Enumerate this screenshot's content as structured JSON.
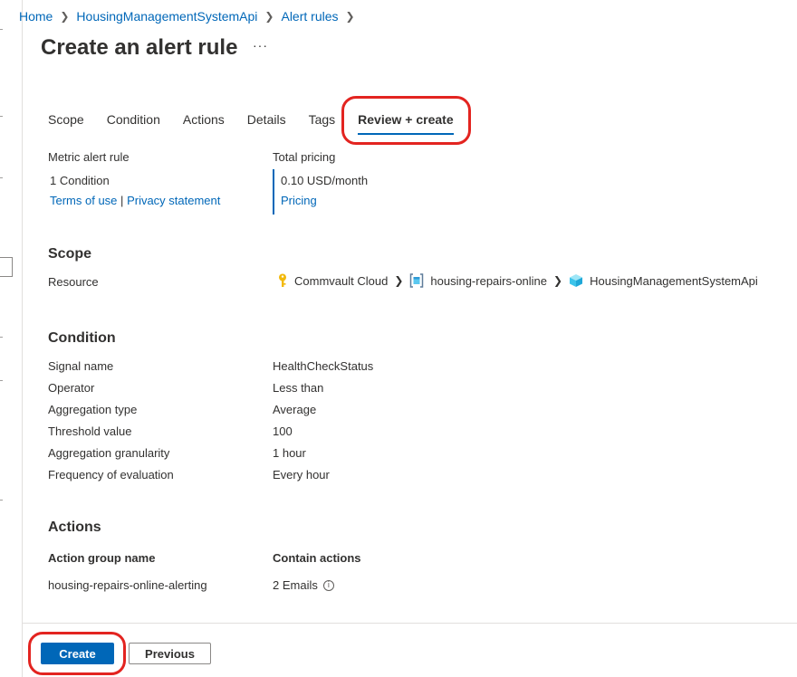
{
  "breadcrumb": {
    "home": "Home",
    "resource": "HousingManagementSystemApi",
    "section": "Alert rules"
  },
  "page": {
    "title": "Create an alert rule",
    "more": "···"
  },
  "tabs": [
    {
      "label": "Scope"
    },
    {
      "label": "Condition"
    },
    {
      "label": "Actions"
    },
    {
      "label": "Details"
    },
    {
      "label": "Tags"
    },
    {
      "label": "Review + create",
      "active": true
    }
  ],
  "summary": {
    "rule_type": "Metric alert rule",
    "condition_count": "1 Condition",
    "terms_link": "Terms of use",
    "link_separator": "|",
    "privacy_link": "Privacy statement",
    "pricing_label": "Total pricing",
    "price": "0.10 USD/month",
    "pricing_link": "Pricing"
  },
  "scope": {
    "title": "Scope",
    "resource_label": "Resource",
    "path": [
      {
        "name": "Commvault Cloud",
        "icon": "key-icon"
      },
      {
        "name": "housing-repairs-online",
        "icon": "resource-group-icon"
      },
      {
        "name": "HousingManagementSystemApi",
        "icon": "app-insights-cube-icon"
      }
    ]
  },
  "condition": {
    "title": "Condition",
    "rows": [
      {
        "label": "Signal name",
        "value": "HealthCheckStatus"
      },
      {
        "label": "Operator",
        "value": "Less than"
      },
      {
        "label": "Aggregation type",
        "value": "Average"
      },
      {
        "label": "Threshold value",
        "value": "100"
      },
      {
        "label": "Aggregation granularity",
        "value": "1 hour"
      },
      {
        "label": "Frequency of evaluation",
        "value": "Every hour"
      }
    ]
  },
  "actions": {
    "title": "Actions",
    "col_group": "Action group name",
    "col_contains": "Contain actions",
    "group_name": "housing-repairs-online-alerting",
    "contains": "2 Emails",
    "info_glyph": "i"
  },
  "footer": {
    "create_label": "Create",
    "previous_label": "Previous"
  },
  "colors": {
    "accent": "#0067b8",
    "highlight": "#e32420",
    "text": "#323130"
  }
}
